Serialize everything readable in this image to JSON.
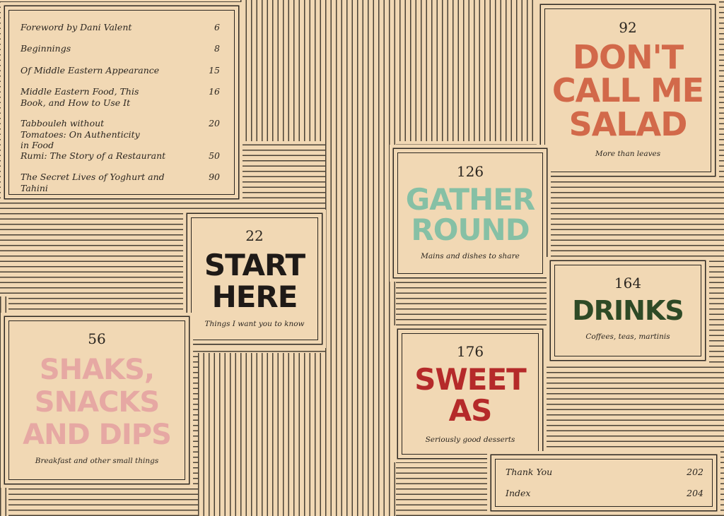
{
  "colors": {
    "background": "#f1d8b4",
    "line": "#2b2620",
    "salad": "#d2694a",
    "gather": "#86c0a5",
    "start": "#1f1a17",
    "drinks": "#2e4a26",
    "sweet": "#b52a2a",
    "shaks": "#e6a8a3"
  },
  "toc": [
    {
      "title": "Foreword by Dani Valent",
      "page": "6"
    },
    {
      "title": "Beginnings",
      "page": "8"
    },
    {
      "title": "Of Middle Eastern Appearance",
      "page": "15"
    },
    {
      "title": "Middle Eastern Food, This Book, and How to Use It",
      "page": "16"
    },
    {
      "title": "Tabbouleh without Tomatoes: On Authenticity in Food",
      "page": "20"
    },
    {
      "title": "Rumi: The Story of a Restaurant",
      "page": "50"
    },
    {
      "title": "The Secret Lives of Yoghurt and Tahini",
      "page": "90"
    }
  ],
  "chapters": {
    "salad": {
      "page": "92",
      "title_line1": "DON'T",
      "title_line2": "CALL ME",
      "title_line3": "SALAD",
      "subtitle": "More than leaves"
    },
    "gather": {
      "page": "126",
      "title_line1": "GATHER",
      "title_line2": "ROUND",
      "subtitle": "Mains and dishes to share"
    },
    "start": {
      "page": "22",
      "title_line1": "START",
      "title_line2": "HERE",
      "subtitle": "Things I want you to know"
    },
    "drinks": {
      "page": "164",
      "title_line1": "DRINKS",
      "subtitle": "Coffees, teas, martinis"
    },
    "shaks": {
      "page": "56",
      "title_line1": "SHAKS,",
      "title_line2": "SNACKS",
      "title_line3": "AND DIPS",
      "subtitle": "Breakfast and other small things"
    },
    "sweet": {
      "page": "176",
      "title_line1": "SWEET",
      "title_line2": "AS",
      "subtitle": "Seriously good desserts"
    }
  },
  "end_matter": [
    {
      "title": "Thank You",
      "page": "202"
    },
    {
      "title": "Index",
      "page": "204"
    }
  ]
}
